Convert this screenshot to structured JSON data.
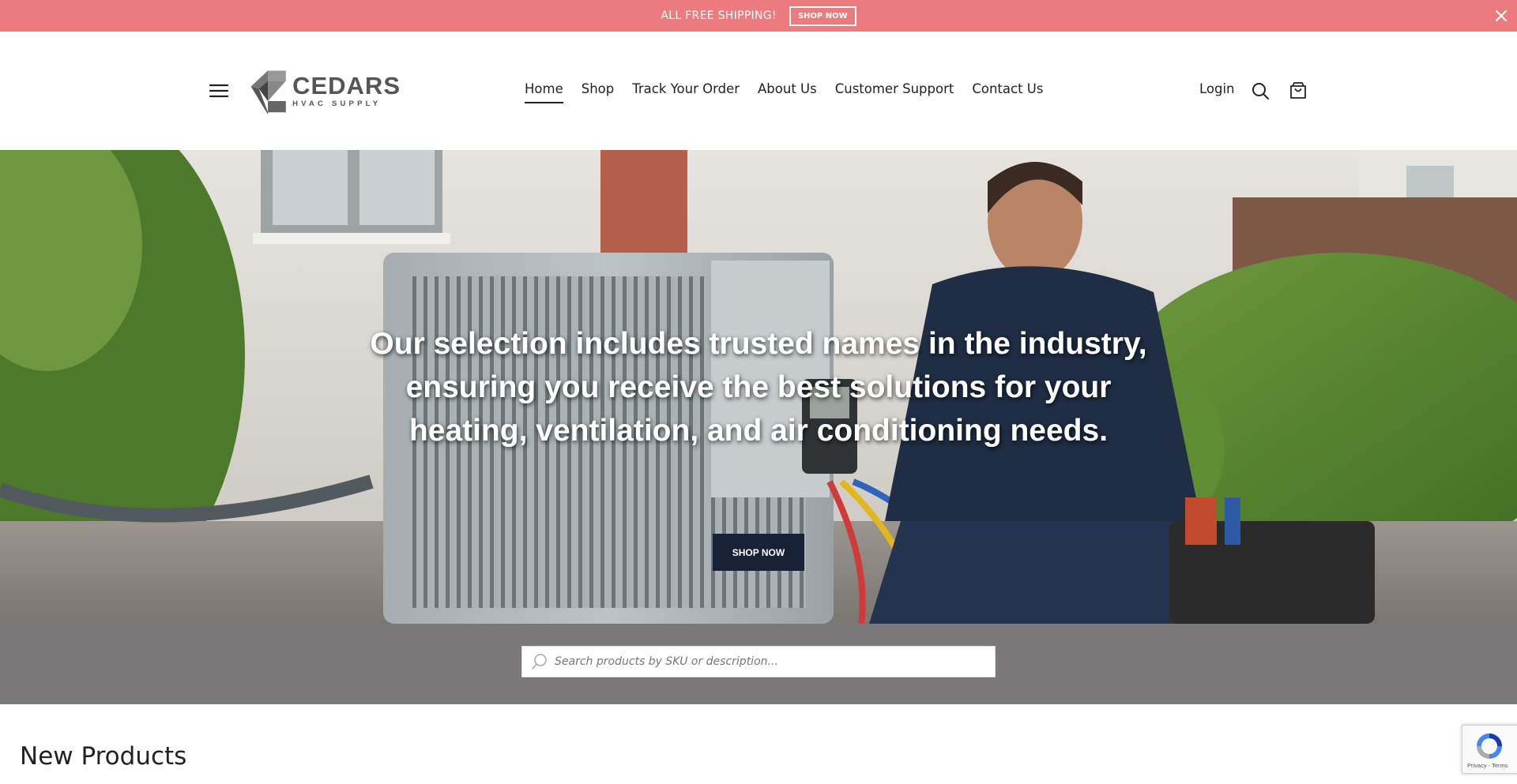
{
  "announcement": {
    "text": "ALL FREE SHIPPING!",
    "button_label": "SHOP NOW"
  },
  "header": {
    "logo_title": "CEDARS",
    "logo_subtitle": "HVAC SUPPLY",
    "nav": [
      {
        "label": "Home",
        "active": true
      },
      {
        "label": "Shop"
      },
      {
        "label": "Track Your Order"
      },
      {
        "label": "About Us"
      },
      {
        "label": "Customer Support"
      },
      {
        "label": "Contact Us"
      }
    ],
    "login_label": "Login"
  },
  "hero": {
    "heading": "Our selection includes trusted names in the industry, ensuring you receive the best solutions for your heating, ventilation, and air conditioning needs.",
    "button_label": "SHOP NOW"
  },
  "search": {
    "placeholder": "Search products by SKU or description..."
  },
  "new_products": {
    "title": "New Products"
  },
  "recaptcha": {
    "links": "Privacy - Terms"
  },
  "colors": {
    "announcement_bg": "#eb7b7e",
    "hero_button_bg": "#182237",
    "search_band_bg": "#7a7879"
  }
}
